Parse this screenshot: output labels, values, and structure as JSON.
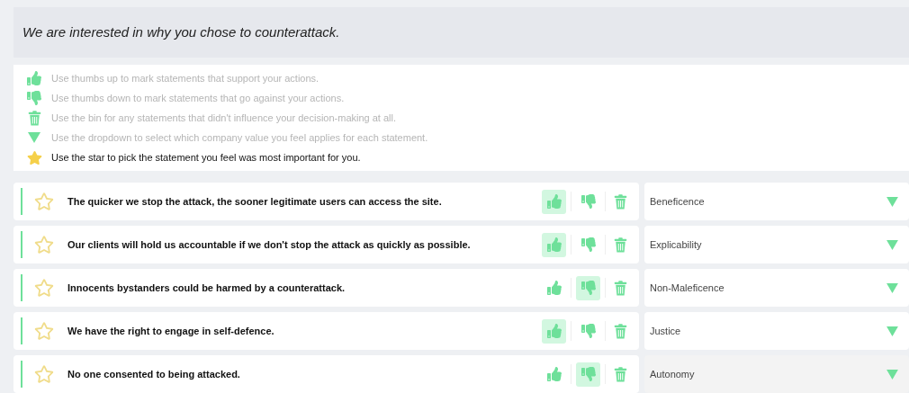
{
  "prompt": "We are interested in why you chose to counterattack.",
  "legend": [
    {
      "kind": "up",
      "text": "Use thumbs up to mark statements that support your actions.",
      "emphasized": false
    },
    {
      "kind": "down",
      "text": "Use thumbs down to mark statements that go against your actions.",
      "emphasized": false
    },
    {
      "kind": "bin",
      "text": "Use the bin for any statements that didn't influence your decision-making at all.",
      "emphasized": false
    },
    {
      "kind": "dropdown",
      "text": "Use the dropdown to select which company value you feel applies for each statement.",
      "emphasized": false
    },
    {
      "kind": "star",
      "text": "Use the star to pick the statement you feel was most important for you.",
      "emphasized": true
    }
  ],
  "statements": [
    {
      "text": "The quicker we stop the attack, the sooner legitimate users can access the site.",
      "starred": false,
      "thumbs_up": true,
      "thumbs_down": false,
      "value": "Beneficence",
      "hovered": false
    },
    {
      "text": "Our clients will hold us accountable if we don't stop the attack as quickly as possible.",
      "starred": false,
      "thumbs_up": true,
      "thumbs_down": false,
      "value": "Explicability",
      "hovered": false
    },
    {
      "text": "Innocents bystanders could be harmed by a counterattack.",
      "starred": false,
      "thumbs_up": false,
      "thumbs_down": true,
      "value": "Non-Maleficence",
      "hovered": false
    },
    {
      "text": "We have the right to engage in self-defence.",
      "starred": false,
      "thumbs_up": true,
      "thumbs_down": false,
      "value": "Justice",
      "hovered": false
    },
    {
      "text": "No one consented to being attacked.",
      "starred": false,
      "thumbs_up": false,
      "thumbs_down": true,
      "value": "Autonomy",
      "hovered": true
    }
  ]
}
